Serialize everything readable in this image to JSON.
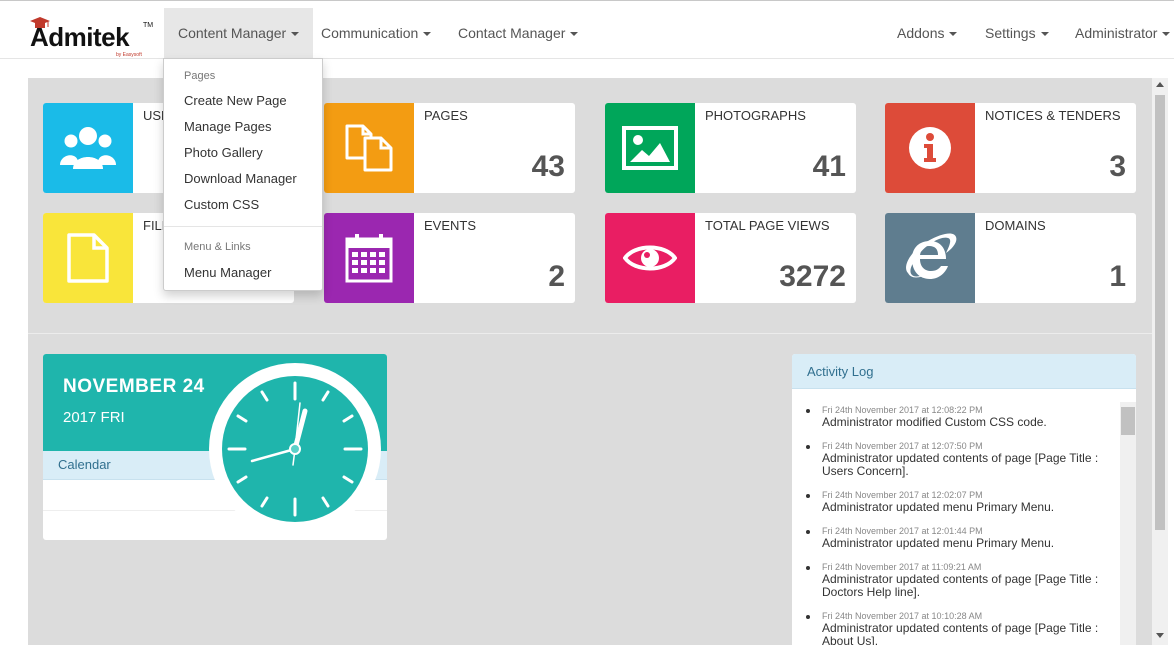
{
  "brand": {
    "name": "Admitek",
    "tm": "TM",
    "sub": "by Easysoft"
  },
  "nav": {
    "left": [
      {
        "label": "Content Manager"
      },
      {
        "label": "Communication"
      },
      {
        "label": "Contact Manager"
      }
    ],
    "right": [
      {
        "label": "Addons"
      },
      {
        "label": "Settings"
      },
      {
        "label": "Administrator"
      }
    ]
  },
  "dropdown": {
    "header1": "Pages",
    "items1": [
      "Create New Page",
      "Manage Pages",
      "Photo Gallery",
      "Download Manager",
      "Custom CSS"
    ],
    "header2": "Menu & Links",
    "items2": [
      "Menu Manager"
    ]
  },
  "tiles": [
    {
      "label": "USE",
      "value": "",
      "color": "#1abbe8",
      "icon": "users-icon"
    },
    {
      "label": "PAGES",
      "value": "43",
      "color": "#f39c12",
      "icon": "pages-icon"
    },
    {
      "label": "PHOTOGRAPHS",
      "value": "41",
      "color": "#00a65a",
      "icon": "photo-icon"
    },
    {
      "label": "NOTICES & TENDERS",
      "value": "3",
      "color": "#dd4b39",
      "icon": "info-icon"
    },
    {
      "label": "FILE",
      "value": "",
      "color": "#f9e53a",
      "icon": "file-icon"
    },
    {
      "label": "EVENTS",
      "value": "2",
      "color": "#9b27b0",
      "icon": "calendar-icon"
    },
    {
      "label": "TOTAL PAGE VIEWS",
      "value": "3272",
      "color": "#e91e63",
      "icon": "eye-icon"
    },
    {
      "label": "DOMAINS",
      "value": "1",
      "color": "#5f7d8f",
      "icon": "ie-icon"
    }
  ],
  "calendar": {
    "date": "NOVEMBER 24",
    "year": "2017 FRI",
    "label": "Calendar"
  },
  "activity": {
    "title": "Activity Log",
    "entries": [
      {
        "ts": "Fri 24th November 2017 at 12:08:22 PM",
        "msg": "Administrator modified Custom CSS code."
      },
      {
        "ts": "Fri 24th November 2017 at 12:07:50 PM",
        "msg": "Administrator updated contents of page [Page Title : Users Concern]."
      },
      {
        "ts": "Fri 24th November 2017 at 12:02:07 PM",
        "msg": "Administrator updated menu Primary Menu."
      },
      {
        "ts": "Fri 24th November 2017 at 12:01:44 PM",
        "msg": "Administrator updated menu Primary Menu."
      },
      {
        "ts": "Fri 24th November 2017 at 11:09:21 AM",
        "msg": "Administrator updated contents of page [Page Title : Doctors Help line]."
      },
      {
        "ts": "Fri 24th November 2017 at 10:10:28 AM",
        "msg": "Administrator updated contents of page [Page Title : About Us]."
      }
    ]
  }
}
